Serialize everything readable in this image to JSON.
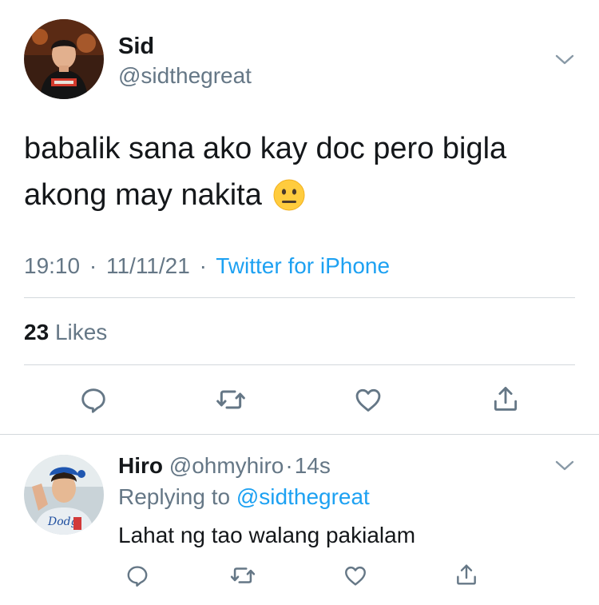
{
  "main_tweet": {
    "author_name": "Sid",
    "author_handle": "@sidthegreat",
    "text_line1": "babalik sana ako kay doc pero bigla",
    "text_line2": "akong may nakita",
    "emoji": "neutral-face-emoji",
    "time": "19:10",
    "date": "11/11/21",
    "source": "Twitter for iPhone",
    "likes_count": "23",
    "likes_label": "Likes",
    "sep": "·"
  },
  "reply": {
    "author_name": "Hiro",
    "author_handle": "@ohmyhiro",
    "age": "14s",
    "sep": "·",
    "replying_prefix": "Replying to",
    "replying_to": "@sidthegreat",
    "text": "Lahat ng tao walang pakialam"
  },
  "icons": {
    "reply": "speech-bubble-icon",
    "retweet": "retweet-icon",
    "like": "heart-icon",
    "share": "share-icon",
    "menu": "chevron-down-icon"
  },
  "colors": {
    "link": "#1da1f2",
    "secondary_text": "#657786",
    "divider": "#d3d8dc"
  }
}
